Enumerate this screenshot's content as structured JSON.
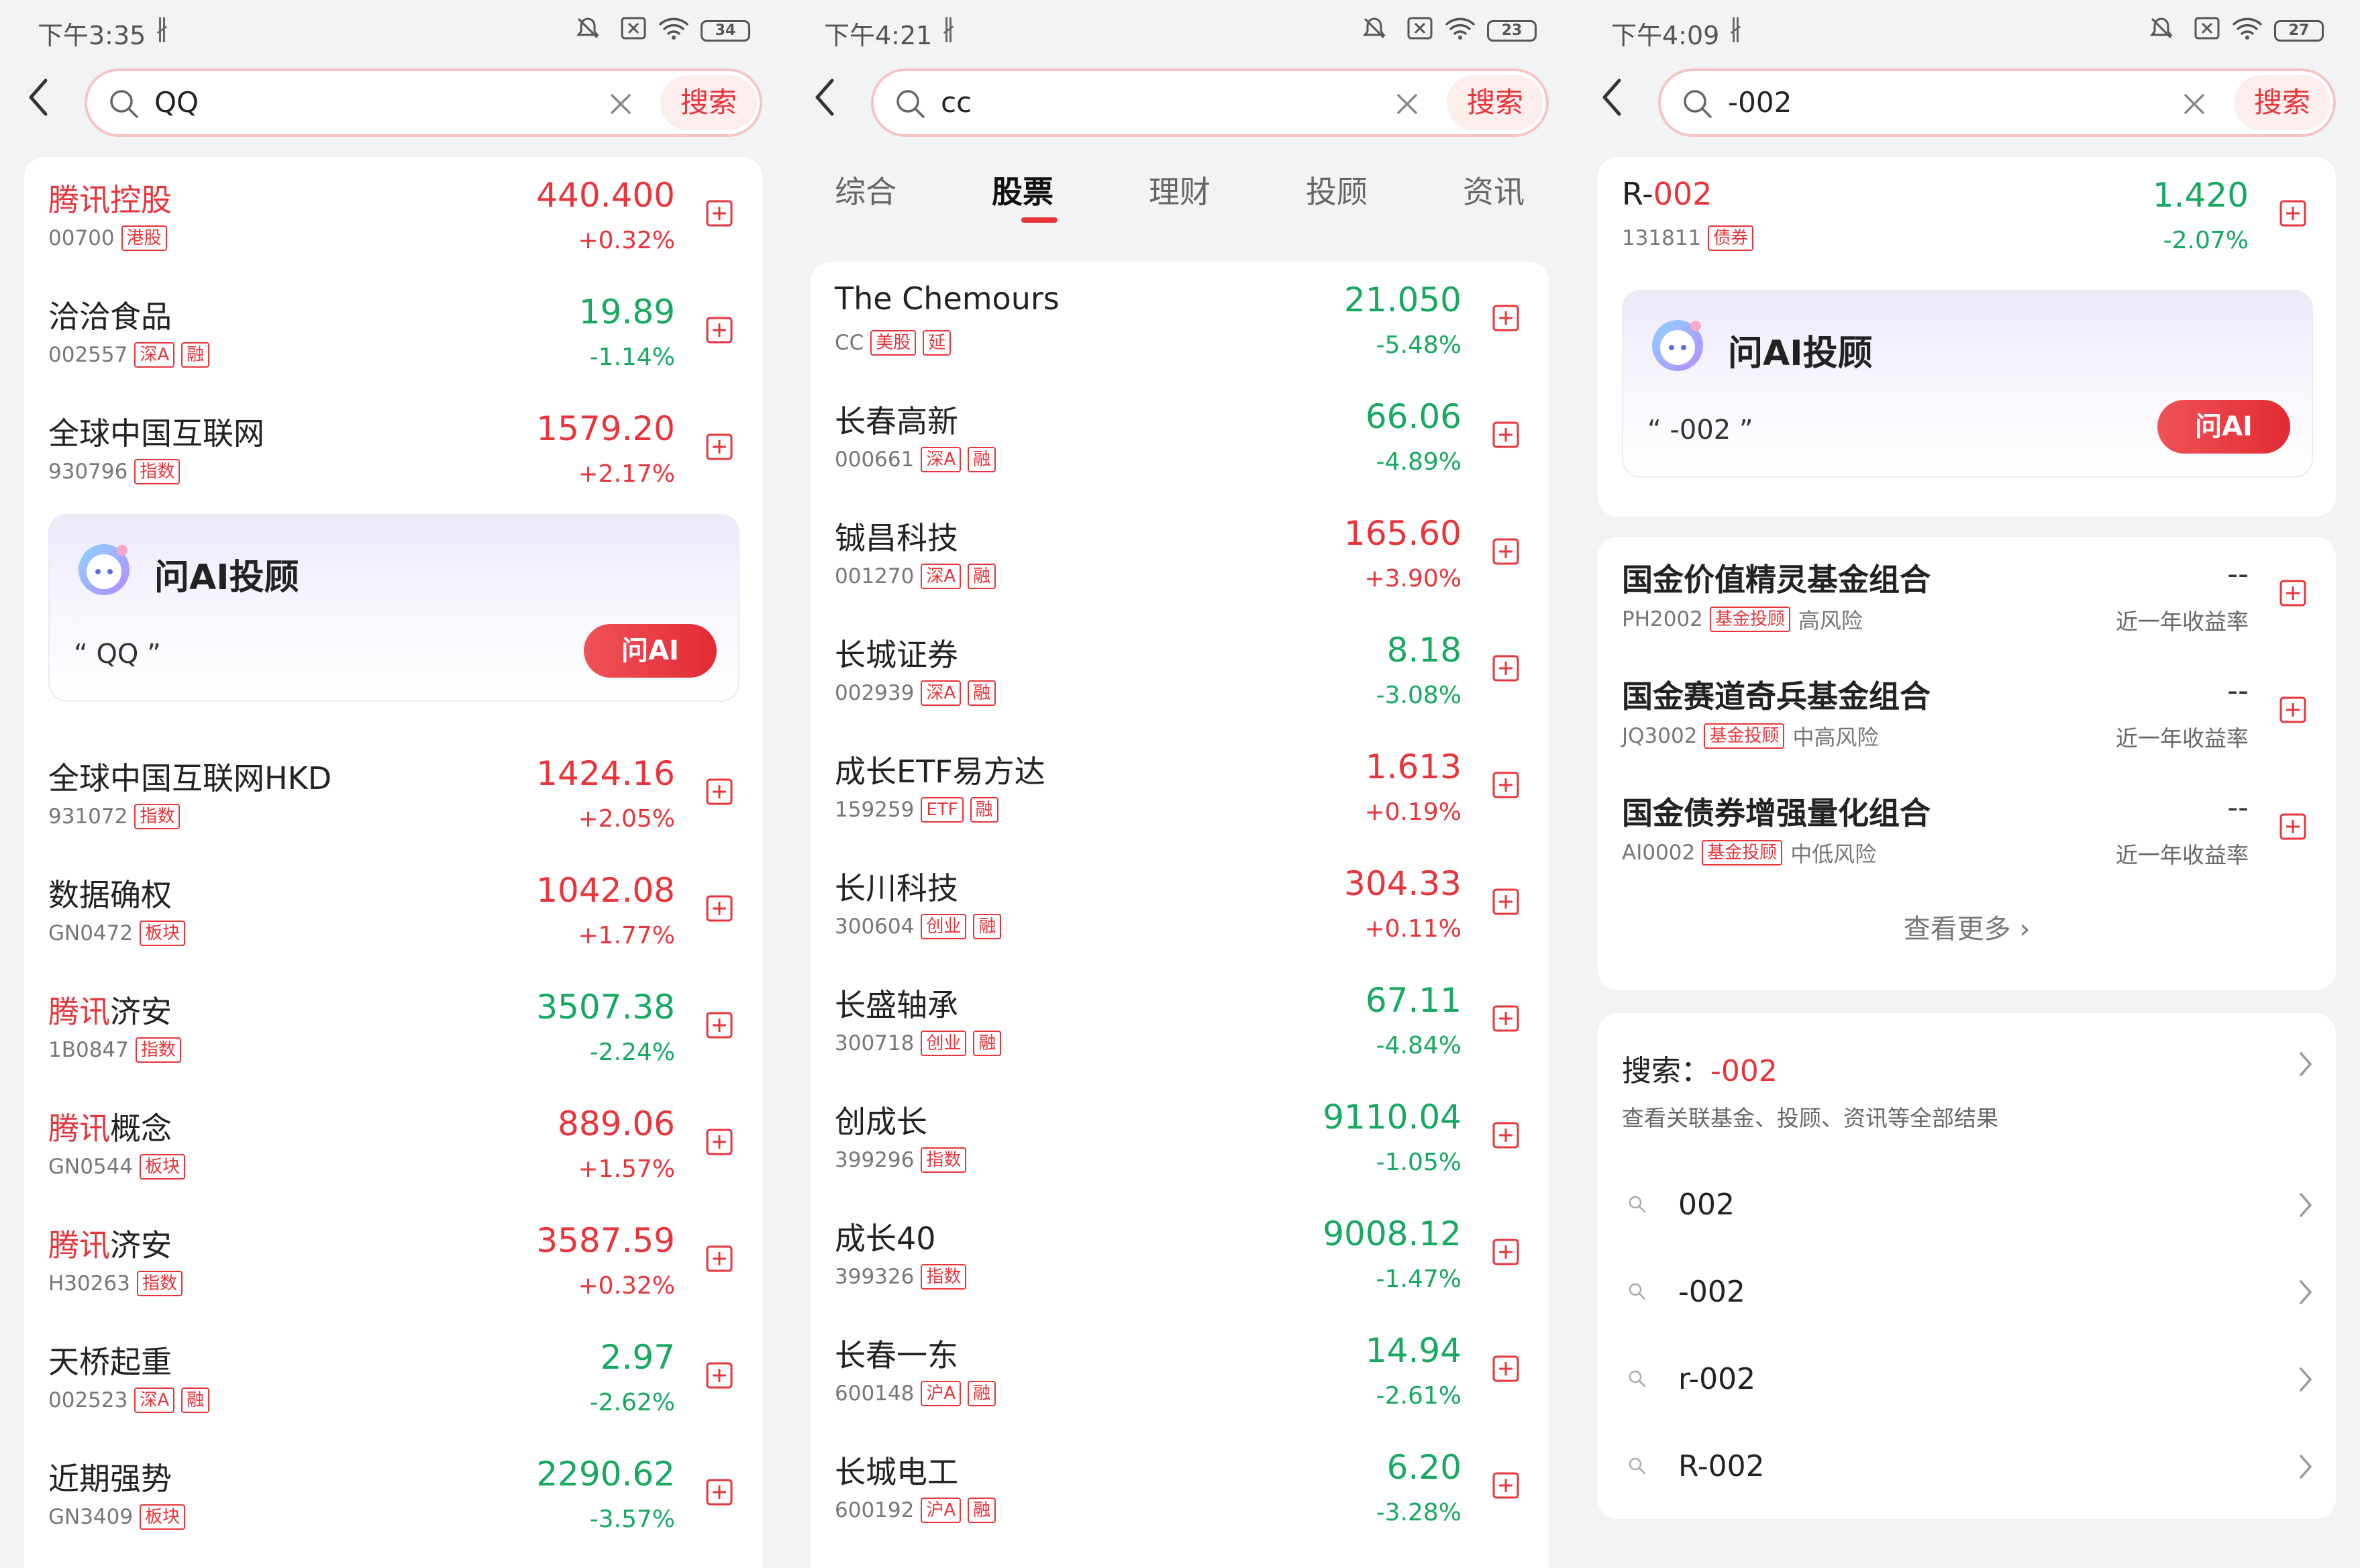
{
  "panels": [
    {
      "status": {
        "time": "下午3:35",
        "battery": "34"
      },
      "search": {
        "query": "QQ",
        "button": "搜索"
      },
      "rows_top": [
        {
          "name_hl": "腾讯控股",
          "name_rest": "",
          "name_red": true,
          "code": "00700",
          "tags": [
            "港股"
          ],
          "price": "440.400",
          "change": "+0.32%",
          "up": true
        },
        {
          "name_hl": "",
          "name_rest": "洽洽食品",
          "name_red": false,
          "code": "002557",
          "tags": [
            "深A",
            "融"
          ],
          "price": "19.89",
          "change": "-1.14%",
          "up": false
        },
        {
          "name_hl": "",
          "name_rest": "全球中国互联网",
          "name_red": false,
          "code": "930796",
          "tags": [
            "指数"
          ],
          "price": "1579.20",
          "change": "+2.17%",
          "up": true
        }
      ],
      "ai": {
        "title": "问AI投顾",
        "query": "“ QQ ”",
        "button": "问AI"
      },
      "rows_bottom": [
        {
          "name_hl": "",
          "name_rest": "全球中国互联网HKD",
          "code": "931072",
          "tags": [
            "指数"
          ],
          "price": "1424.16",
          "change": "+2.05%",
          "up": true
        },
        {
          "name_hl": "",
          "name_rest": "数据确权",
          "code": "GN0472",
          "tags": [
            "板块"
          ],
          "price": "1042.08",
          "change": "+1.77%",
          "up": true
        },
        {
          "name_hl": "腾讯",
          "name_rest": "济安",
          "code": "1B0847",
          "tags": [
            "指数"
          ],
          "price": "3507.38",
          "change": "-2.24%",
          "up": false
        },
        {
          "name_hl": "腾讯",
          "name_rest": "概念",
          "code": "GN0544",
          "tags": [
            "板块"
          ],
          "price": "889.06",
          "change": "+1.57%",
          "up": true
        },
        {
          "name_hl": "腾讯",
          "name_rest": "济安",
          "code": "H30263",
          "tags": [
            "指数"
          ],
          "price": "3587.59",
          "change": "+0.32%",
          "up": true
        },
        {
          "name_hl": "",
          "name_rest": "天桥起重",
          "code": "002523",
          "tags": [
            "深A",
            "融"
          ],
          "price": "2.97",
          "change": "-2.62%",
          "up": false
        },
        {
          "name_hl": "",
          "name_rest": "近期强势",
          "code": "GN3409",
          "tags": [
            "板块"
          ],
          "price": "2290.62",
          "change": "-3.57%",
          "up": false
        }
      ]
    },
    {
      "status": {
        "time": "下午4:21",
        "battery": "23"
      },
      "search": {
        "query": "cc",
        "button": "搜索"
      },
      "tabs": [
        "综合",
        "股票",
        "理财",
        "投顾",
        "资讯"
      ],
      "active_tab": 1,
      "rows": [
        {
          "name": "The Chemours",
          "code": "CC",
          "tags": [
            "美股",
            "延"
          ],
          "price": "21.050",
          "change": "-5.48%",
          "up": false
        },
        {
          "name": "长春高新",
          "code": "000661",
          "tags": [
            "深A",
            "融"
          ],
          "price": "66.06",
          "change": "-4.89%",
          "up": false
        },
        {
          "name": "铖昌科技",
          "code": "001270",
          "tags": [
            "深A",
            "融"
          ],
          "price": "165.60",
          "change": "+3.90%",
          "up": true
        },
        {
          "name": "长城证券",
          "code": "002939",
          "tags": [
            "深A",
            "融"
          ],
          "price": "8.18",
          "change": "-3.08%",
          "up": false
        },
        {
          "name": "成长ETF易方达",
          "code": "159259",
          "tags": [
            "ETF",
            "融"
          ],
          "price": "1.613",
          "change": "+0.19%",
          "up": true
        },
        {
          "name": "长川科技",
          "code": "300604",
          "tags": [
            "创业",
            "融"
          ],
          "price": "304.33",
          "change": "+0.11%",
          "up": true
        },
        {
          "name": "长盛轴承",
          "code": "300718",
          "tags": [
            "创业",
            "融"
          ],
          "price": "67.11",
          "change": "-4.84%",
          "up": false
        },
        {
          "name": "创成长",
          "code": "399296",
          "tags": [
            "指数"
          ],
          "price": "9110.04",
          "change": "-1.05%",
          "up": false
        },
        {
          "name": "成长40",
          "code": "399326",
          "tags": [
            "指数"
          ],
          "price": "9008.12",
          "change": "-1.47%",
          "up": false
        },
        {
          "name": "长春一东",
          "code": "600148",
          "tags": [
            "沪A",
            "融"
          ],
          "price": "14.94",
          "change": "-2.61%",
          "up": false
        },
        {
          "name": "长城电工",
          "code": "600192",
          "tags": [
            "沪A",
            "融"
          ],
          "price": "6.20",
          "change": "-3.28%",
          "up": false
        }
      ]
    },
    {
      "status": {
        "time": "下午4:09",
        "battery": "27"
      },
      "search": {
        "query": "-002",
        "button": "搜索"
      },
      "bond": {
        "name_pre": "R-",
        "name_hl": "002",
        "code": "131811",
        "tag": "债券",
        "price": "1.420",
        "change": "-2.07%"
      },
      "ai": {
        "title": "问AI投顾",
        "query": "“ -002 ”",
        "button": "问AI"
      },
      "funds": [
        {
          "name": "国金价值精灵基金组合",
          "code": "PH2002",
          "tag": "基金投顾",
          "risk": "高风险",
          "value": "--",
          "label": "近一年收益率"
        },
        {
          "name": "国金赛道奇兵基金组合",
          "code": "JQ3002",
          "tag": "基金投顾",
          "risk": "中高风险",
          "value": "--",
          "label": "近一年收益率"
        },
        {
          "name": "国金债券增强量化组合",
          "code": "AI0002",
          "tag": "基金投顾",
          "risk": "中低风险",
          "value": "--",
          "label": "近一年收益率"
        }
      ],
      "more": "查看更多",
      "search_all": {
        "prefix": "搜索：",
        "term": "-002",
        "desc": "查看关联基金、投顾、资讯等全部结果"
      },
      "suggestions": [
        "002",
        "-002",
        "r-002",
        "R-002"
      ]
    }
  ],
  "colors": {
    "red": "#e8343b",
    "green": "#17a861",
    "bg": "#f2f3f5"
  }
}
